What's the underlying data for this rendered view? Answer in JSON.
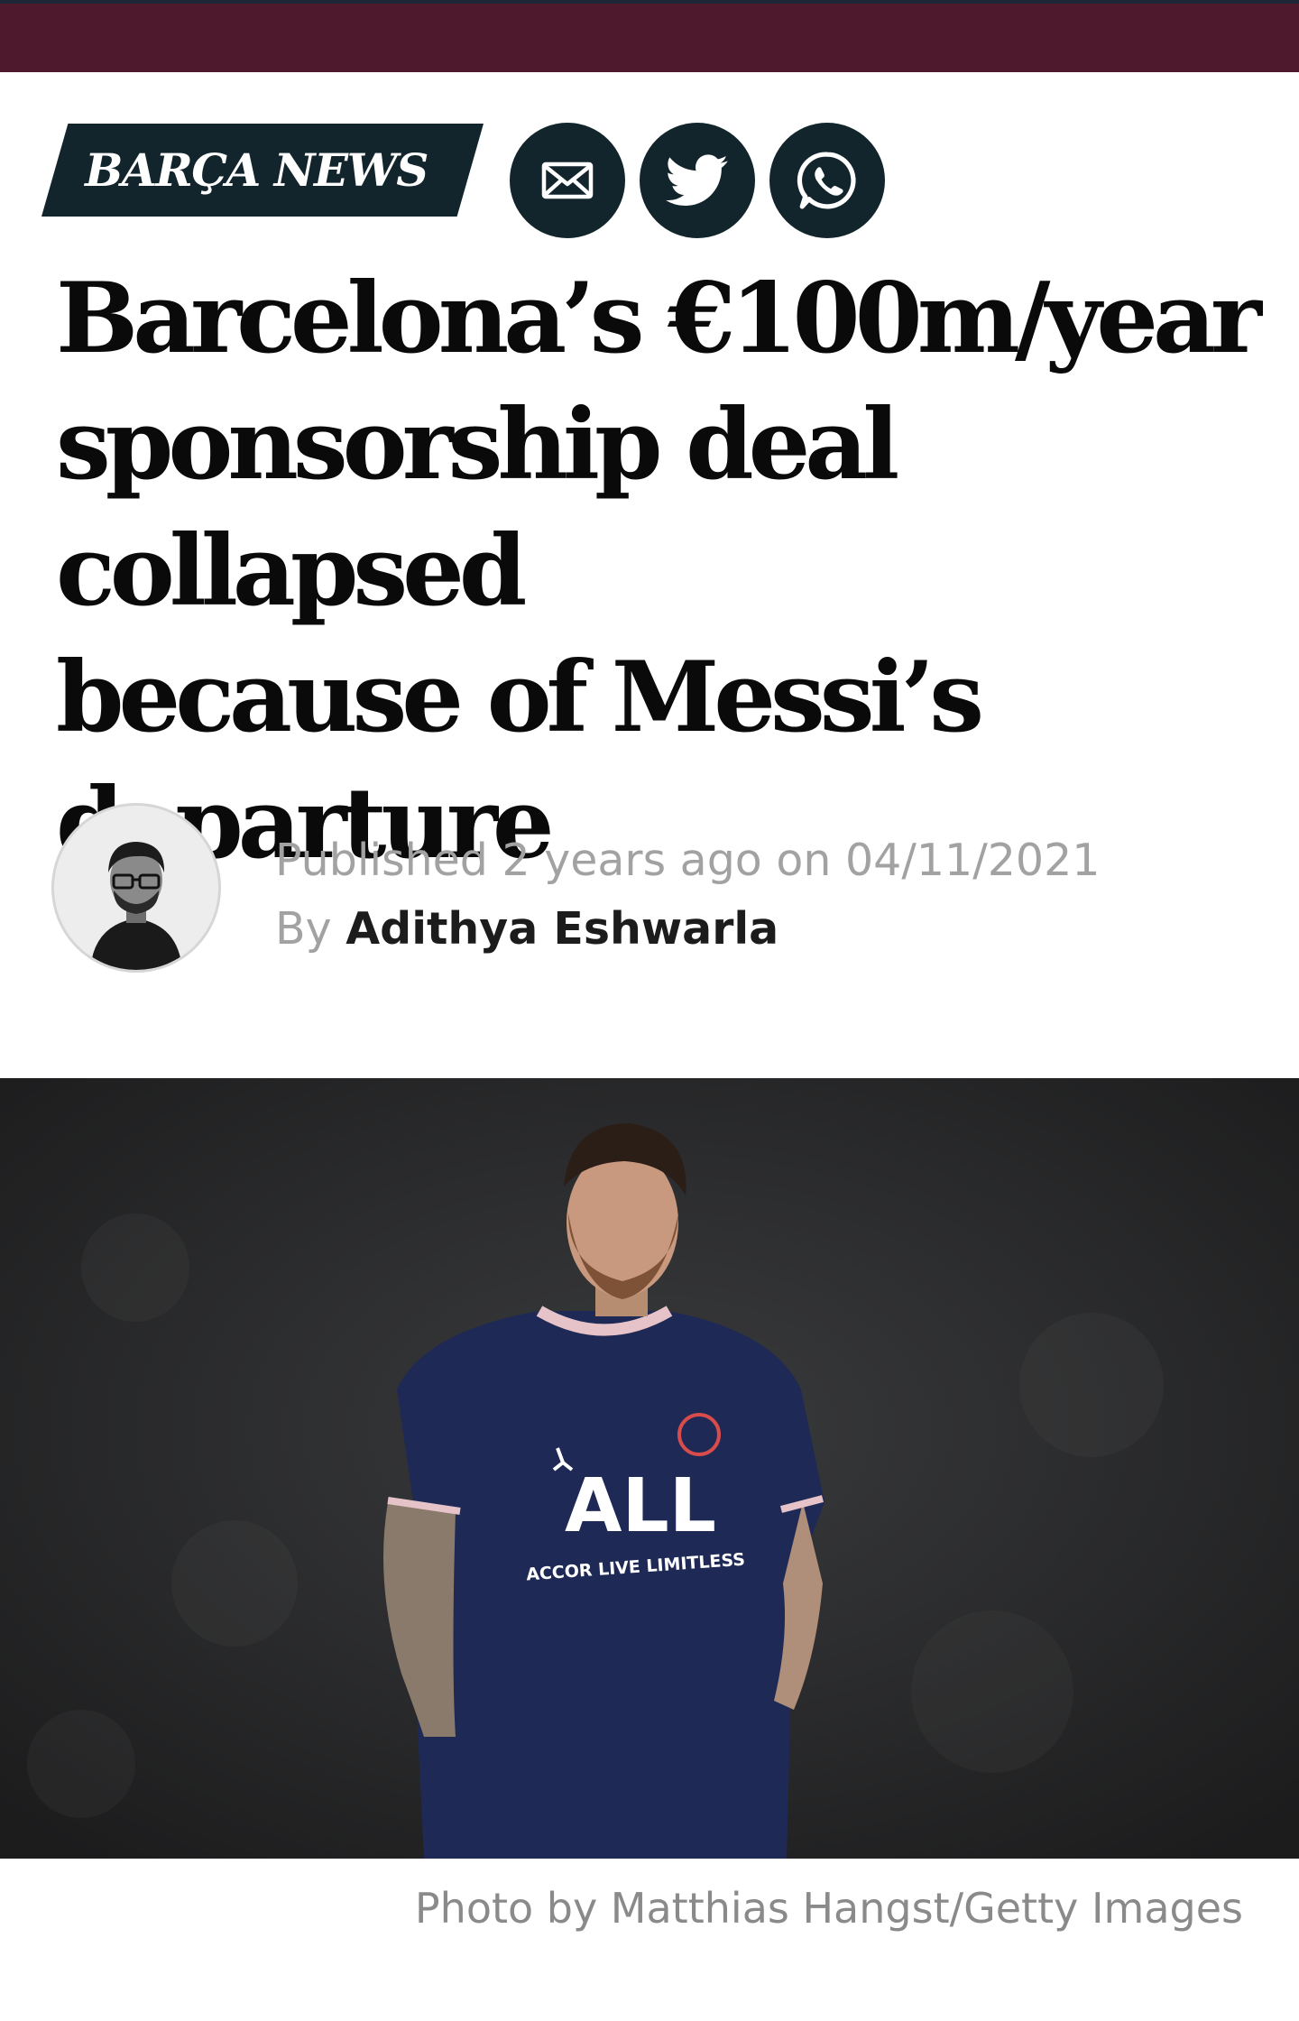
{
  "header": {
    "bar_color": "#4f192d"
  },
  "article": {
    "category": "BARÇA NEWS",
    "share": [
      {
        "name": "email",
        "icon": "mail-icon"
      },
      {
        "name": "twitter",
        "icon": "twitter-bird-icon"
      },
      {
        "name": "whatsapp",
        "icon": "whatsapp-icon"
      }
    ],
    "headline_lines": [
      "Barcelona’s €100m/year",
      "sponsorship deal collapsed",
      "because of Messi’s",
      "departure"
    ],
    "meta": {
      "published_prefix": "Published",
      "relative_time": "2 years ago",
      "on": "on",
      "date": "04/11/2021",
      "by": "By",
      "author": "Adithya Eshwarla"
    },
    "photo": {
      "sponsor": "ALL",
      "sponsor_sub": "ACCOR LIVE LIMITLESS",
      "caption": "Photo by Matthias Hangst/Getty Images"
    }
  },
  "colors": {
    "dark_navy": "#12252d",
    "gray_text": "#a2a2a2"
  }
}
